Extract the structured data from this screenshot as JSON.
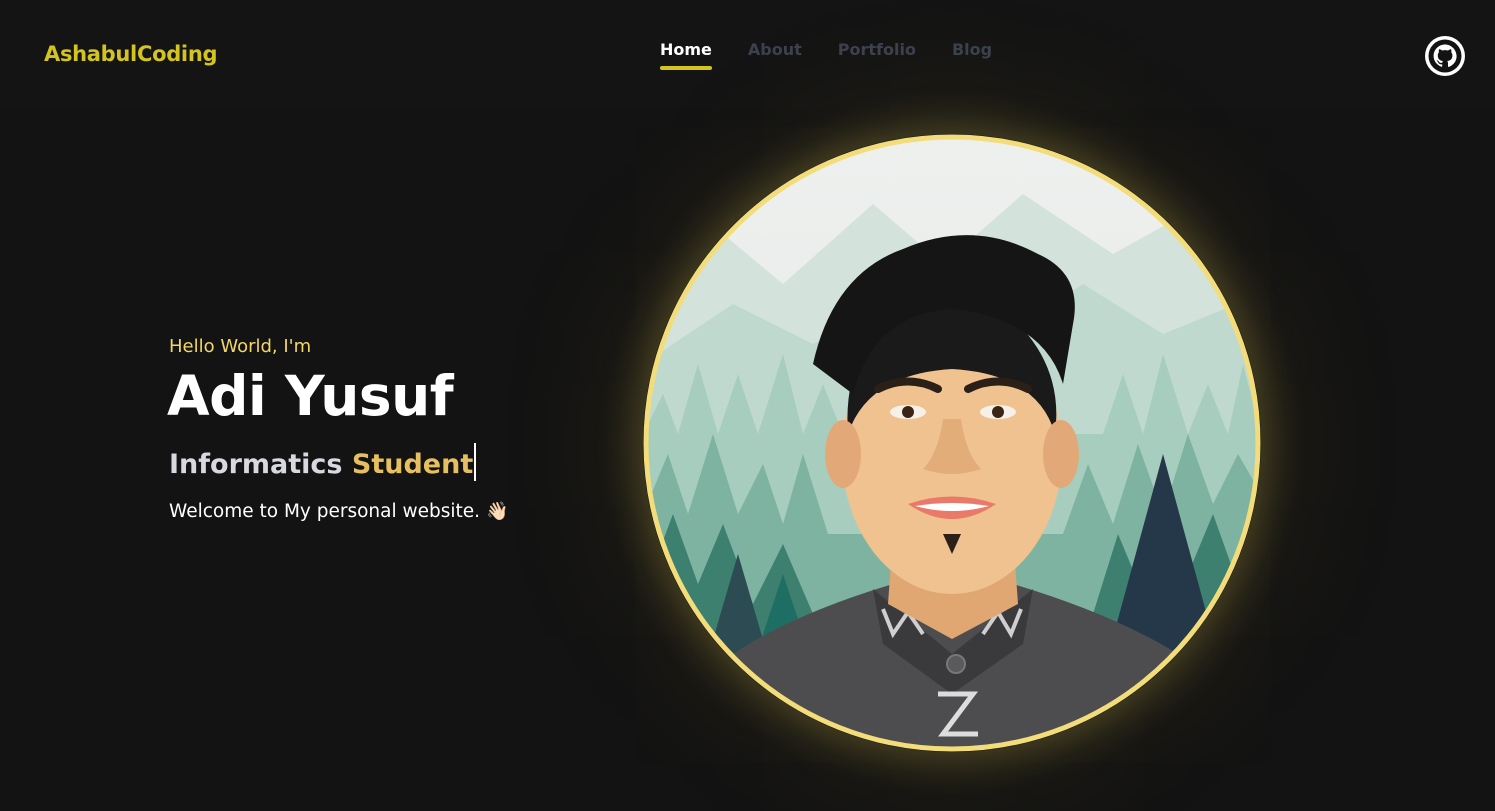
{
  "header": {
    "brand": "AshabulCoding",
    "nav": [
      {
        "label": "Home",
        "active": true
      },
      {
        "label": "About",
        "active": false
      },
      {
        "label": "Portfolio",
        "active": false
      },
      {
        "label": "Blog",
        "active": false
      }
    ],
    "github_icon": "github-icon"
  },
  "hero": {
    "greeting": "Hello World, I'm",
    "name": "Adi Yusuf",
    "role_part1": "Informatics",
    "role_part2": "Student",
    "welcome": "Welcome to My personal website.",
    "wave_icon": "👋🏻"
  },
  "colors": {
    "background": "#131313",
    "accent": "#d4c41f",
    "greeting": "#f2d666",
    "role_highlight": "#e6c060",
    "nav_inactive": "#3c4150",
    "ring": "#f3dc7a"
  }
}
